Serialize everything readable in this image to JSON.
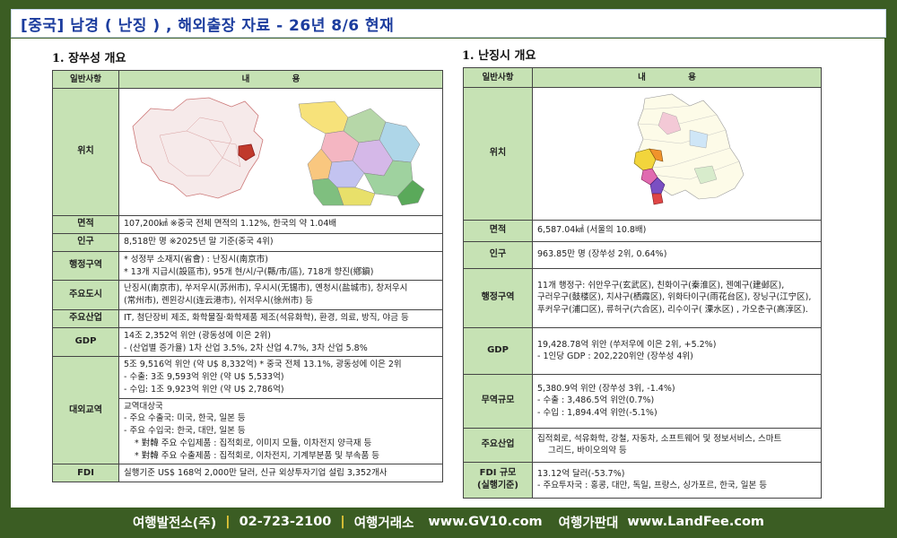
{
  "header": {
    "title": "[중국] 남경 ( 난징 ) , 해외출장 자료 - 26년 8/6 현재"
  },
  "left": {
    "section_title": "1. 장쑤성 개요",
    "col_label": "일반사항",
    "col_content": "내 용",
    "rows": {
      "location": {
        "label": "위치"
      },
      "area": {
        "label": "면적",
        "text": "107,200㎢ ※중국 전체 면적의 1.12%, 한국의 약 1.04배"
      },
      "population": {
        "label": "인구",
        "text": "8,518만 명 ※2025년 말 기준(중국 4위)"
      },
      "admin": {
        "label": "행정구역",
        "lines": [
          "* 성정부 소재지(省會) : 난징시(南京市)",
          "* 13개 지급시(設區市), 95개 현/시/구(縣/市/區), 718개 향진(鄕鎭)"
        ]
      },
      "cities": {
        "label": "주요도시",
        "lines": [
          "난징시(南京市), 쑤저우시(苏州市), 우시시(无锡市), 옌청시(盐城市), 창저우시",
          "(常州市), 롄윈강시(连云港市), 쉬저우시(徐州市) 등"
        ]
      },
      "industry": {
        "label": "주요산업",
        "text": "IT, 첨단장비 제조, 화학물질·화학제품 제조(석유화학), 환경, 의료, 방직, 야금 등"
      },
      "gdp": {
        "label": "GDP",
        "lines": [
          "14조 2,352억 위안 (광동성에 이은 2위)",
          "- (산업별 증가율) 1차 산업 3.5%, 2차 산업 4.7%, 3차 산업 5.8%"
        ]
      },
      "trade": {
        "label": "대외교역",
        "lines1": [
          "5조 9,516억 위안 (약 U$ 8,332억) * 중국 전체 13.1%, 광동성에 이은 2위",
          "- 수출: 3조 9,593억 위안 (약 U$ 5,533억)",
          "- 수입: 1조 9,923억 위안 (약 U$ 2,786억)"
        ],
        "lines2": [
          "교역대상국",
          "- 주요 수출국: 미국, 한국, 일본 등",
          "- 주요 수입국: 한국, 대만, 일본 등",
          "* 對韓 주요 수입제품 : 집적회로, 이미지 모듈, 이차전지 양극재 등",
          "* 對韓 주요 수출제품 : 집적회로, 이차전지, 기계부분품 및 부속품 등"
        ]
      },
      "fdi": {
        "label": "FDI",
        "text": "실행기준 US$ 168억 2,000만 달러, 신규 외상투자기업 설립 3,352개사"
      }
    }
  },
  "right": {
    "section_title": "1. 난징시 개요",
    "col_label": "일반사항",
    "col_content": "내 용",
    "rows": {
      "location": {
        "label": "위치"
      },
      "area": {
        "label": "면적",
        "text": "6,587.04㎢ (서울의 10.8배)"
      },
      "population": {
        "label": "인구",
        "text": "963.85만 명 (장쑤성 2위, 0.64%)"
      },
      "admin": {
        "label": "행정구역",
        "lines": [
          "11개 행정구: 쉬안우구(玄武区), 친화이구(秦淮区), 젠예구(建邺区),",
          "구러우구(鼓楼区), 치샤구(栖霞区), 위화타이구(雨花台区), 장닝구(江宁区),",
          "푸커우구(浦口区), 류허구(六合区), 리수이구( 溧水区) , 가오춘구(高淳区)."
        ]
      },
      "gdp": {
        "label": "GDP",
        "lines": [
          "19,428.78억 위안 (쑤저우에 이은 2위, +5.2%)",
          "- 1인당 GDP : 202,220위안 (장쑤성 4위)"
        ]
      },
      "trade": {
        "label": "무역규모",
        "lines": [
          "5,380.9억 위안 (장쑤성 3위, -1.4%)",
          "- 수출 : 3,486.5억 위안(0.7%)",
          "- 수입 : 1,894.4억 위안(-5.1%)"
        ]
      },
      "industry": {
        "label": "주요산업",
        "lines": [
          "집적회로, 석유화학, 강철, 자동차, 소프트웨어 및 정보서비스, 스마트",
          "그리드, 바이오의약 등"
        ]
      },
      "fdi": {
        "label_line1": "FDI 규모",
        "label_line2": "(실행기준)",
        "lines": [
          "13.12억 달러(-53.7%)",
          "- 주요투자국 : 홍콩, 대만, 독일, 프랑스, 싱가포르, 한국, 일본 등"
        ]
      }
    }
  },
  "footer": {
    "company": "여행발전소(주)",
    "phone": "02-723-2100",
    "label1": "여행거래소",
    "site1": "www.GV10.com",
    "label2": "여행가판대",
    "site2": "www.LandFee.com"
  },
  "colors": {
    "header_fill": "#c6e2b4",
    "frame": "#3b5d23",
    "title_text": "#1c3d9e",
    "footer_separator": "#f3d03a"
  }
}
